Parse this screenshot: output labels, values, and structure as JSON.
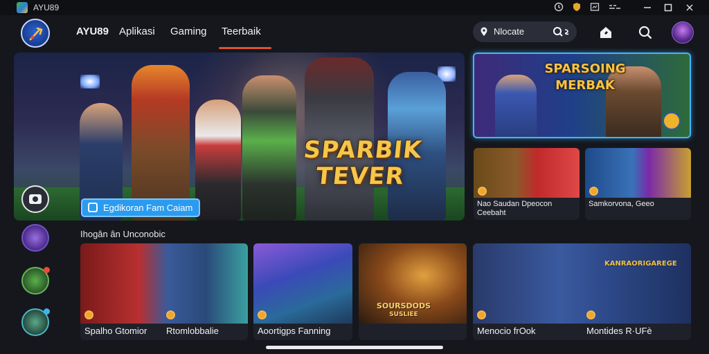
{
  "window": {
    "title": "AYU89"
  },
  "nav": {
    "brand": "AYU89",
    "links": [
      "Aplikasi",
      "Gaming",
      "Teerbaik"
    ],
    "active_index": 2,
    "search_text": "Nlocate",
    "search_icon_text": "Q´s"
  },
  "hero": {
    "title_line1": "SPARBIK",
    "title_line2": "TEVER",
    "button_label": "Egdikoran Fam Caiam"
  },
  "promo_main": {
    "title_line1": "SPARSOING",
    "title_line2": "MERBAK"
  },
  "promo_small": [
    {
      "caption_line1": "Nao Saudan Dpeocon",
      "caption_line2": "Ceebaht"
    },
    {
      "caption_line1": "Samkorvona, Geeo",
      "caption_line2": ""
    }
  ],
  "section": {
    "title": "Ihogân ân Unconobic"
  },
  "cards": [
    {
      "caption": "Spalho Gtomior"
    },
    {
      "caption": "Rtomlobbalie"
    },
    {
      "caption": "Aoortigps Fanning"
    },
    {
      "caption": "",
      "overlay_line1": "SOURSDODS",
      "overlay_line2": "SUSLIEE"
    },
    {
      "caption": "Menocio frOok"
    },
    {
      "caption": "Montides R·UFè",
      "overlay_line1": "KANRAORIGAREGE"
    }
  ],
  "colors": {
    "background": "#15171d",
    "accent": "#e0522e",
    "hero_button": "#2a9bf0",
    "title_gold": "#f5c64a",
    "promo_border": "#42b6ff"
  }
}
